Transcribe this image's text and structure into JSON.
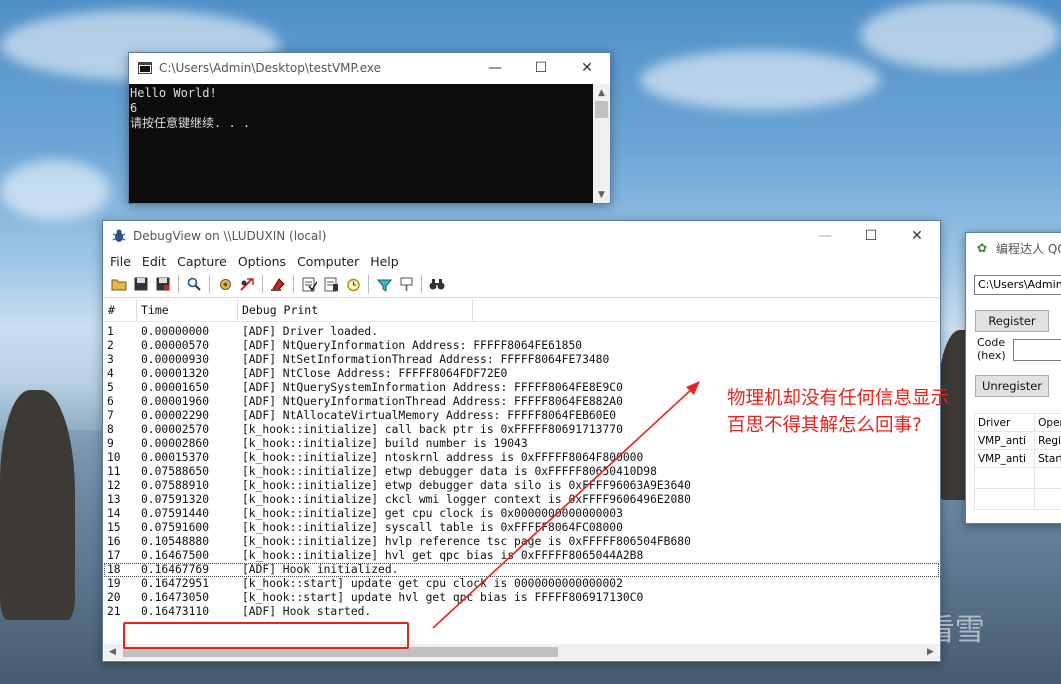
{
  "console_window": {
    "title": "C:\\Users\\Admin\\Desktop\\testVMP.exe",
    "lines": [
      "Hello World!",
      "6",
      "请按任意键继续. . ."
    ]
  },
  "debugview": {
    "title": "DebugView on \\\\LUDUXIN (local)",
    "menu": [
      "File",
      "Edit",
      "Capture",
      "Options",
      "Computer",
      "Help"
    ],
    "columns": [
      "#",
      "Time",
      "Debug Print"
    ],
    "rows": [
      [
        "1",
        "0.00000000",
        "[ADF] Driver loaded."
      ],
      [
        "2",
        "0.00000570",
        "[ADF] NtQueryInformation Address: FFFFF8064FE61850"
      ],
      [
        "3",
        "0.00000930",
        "[ADF] NtSetInformationThread Address: FFFFF8064FE73480"
      ],
      [
        "4",
        "0.00001320",
        "[ADF] NtClose Address: FFFFF8064FDF72E0"
      ],
      [
        "5",
        "0.00001650",
        "[ADF] NtQuerySystemInformation Address: FFFFF8064FE8E9C0"
      ],
      [
        "6",
        "0.00001960",
        "[ADF] NtQueryInformationThread Address: FFFFF8064FE882A0"
      ],
      [
        "7",
        "0.00002290",
        "[ADF] NtAllocateVirtualMemory Address: FFFFF8064FEB60E0"
      ],
      [
        "8",
        "0.00002570",
        "[k_hook::initialize] call back ptr is 0xFFFFF80691713770"
      ],
      [
        "9",
        "0.00002860",
        "[k_hook::initialize] build number is 19043"
      ],
      [
        "10",
        "0.00015370",
        "[k_hook::initialize] ntoskrnl address is 0xFFFFF8064F800000"
      ],
      [
        "11",
        "0.07588650",
        "[k_hook::initialize] etwp debugger data is 0xFFFFF80650410D98"
      ],
      [
        "12",
        "0.07588910",
        "[k_hook::initialize] etwp debugger data silo is 0xFFFF96063A9E3640"
      ],
      [
        "13",
        "0.07591320",
        "[k_hook::initialize] ckcl wmi logger context is 0xFFFF9606496E2080"
      ],
      [
        "14",
        "0.07591440",
        "[k_hook::initialize] get cpu clock is 0x0000000000000003"
      ],
      [
        "15",
        "0.07591600",
        "[k_hook::initialize] syscall table is 0xFFFFF8064FC08000"
      ],
      [
        "16",
        "0.10548880",
        "[k_hook::initialize] hvlp reference tsc page is 0xFFFFF806504FB680"
      ],
      [
        "17",
        "0.16467500",
        "[k_hook::initialize] hvl get qpc bias is 0xFFFFF8065044A2B8"
      ],
      [
        "18",
        "0.16467769",
        "[ADF] Hook initialized."
      ],
      [
        "19",
        "0.16472951",
        "[k_hook::start] update get cpu clock is 0000000000000002"
      ],
      [
        "20",
        "0.16473050",
        "[k_hook::start] update hvl get qpc bias is FFFFF806917130C0"
      ],
      [
        "21",
        "0.16473110",
        "[ADF] Hook started."
      ]
    ],
    "selected_row": "18"
  },
  "side_window": {
    "title": "编程达人 QQ",
    "path": "C:\\Users\\Admin\\D",
    "register_label": "Register",
    "code_label_1": "Code",
    "code_label_2": "(hex)",
    "unregister_label": "Unregister",
    "table_header": [
      "Driver",
      "Opera"
    ],
    "table_rows": [
      [
        "VMP_anti",
        "Regis"
      ],
      [
        "VMP_anti",
        "Start"
      ]
    ]
  },
  "annotation": {
    "line1": "物理机却没有任何信息显示",
    "line2": "百思不得其解怎么回事?"
  },
  "watermark": {
    "text": "看雪"
  },
  "colors": {
    "annotation_red": "#e8231b",
    "console_bg": "#0c0c0c"
  }
}
